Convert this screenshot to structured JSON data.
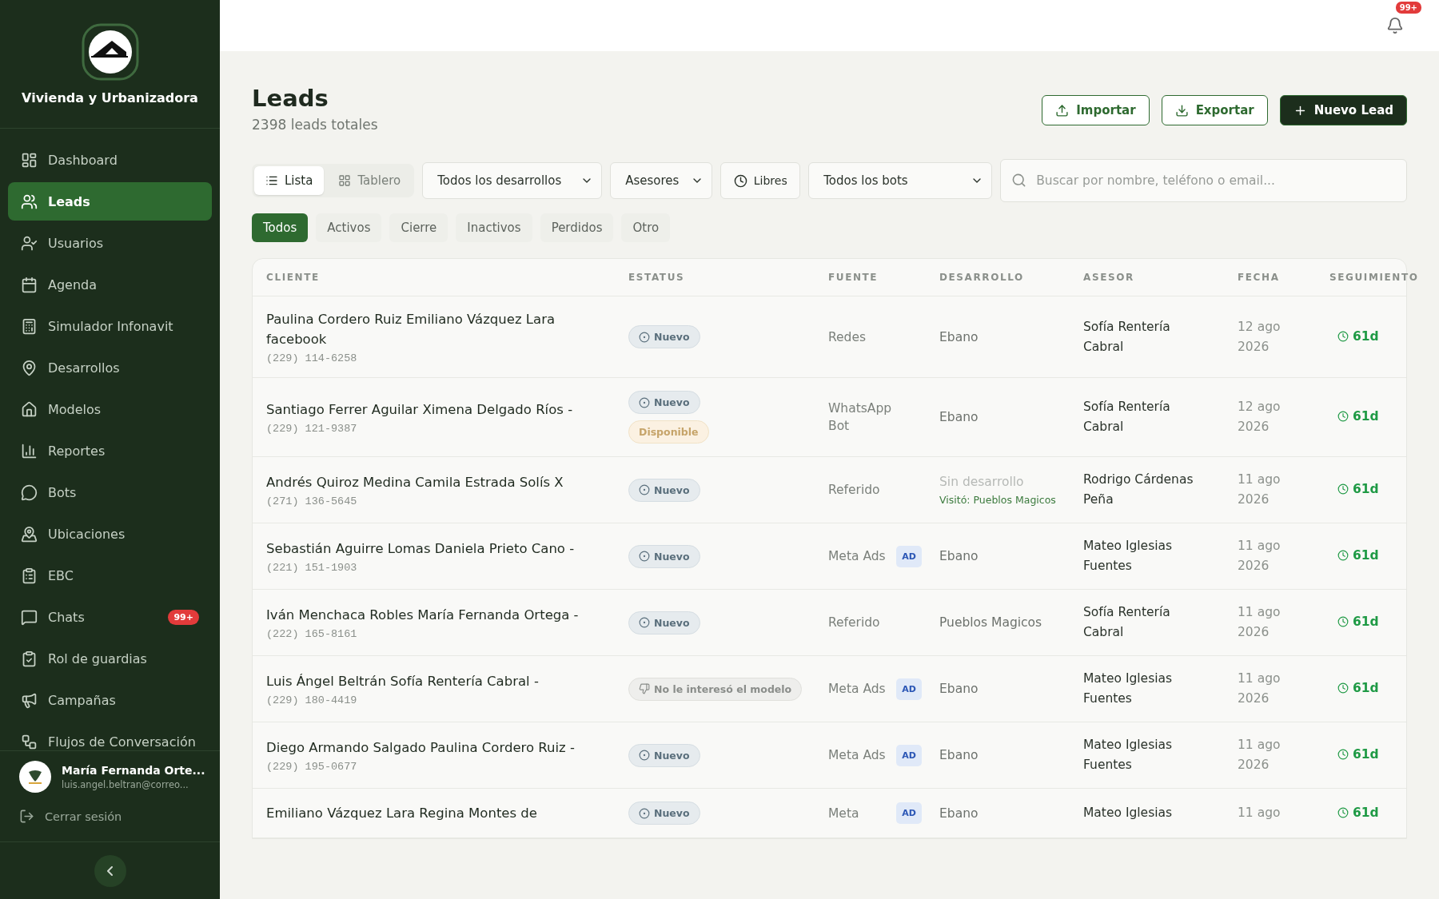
{
  "sidebar": {
    "brand": "Vivienda y Urbanizadora",
    "nav": [
      {
        "label": "Dashboard",
        "selected": false
      },
      {
        "label": "Leads",
        "selected": true
      },
      {
        "label": "Usuarios",
        "selected": false
      },
      {
        "label": "Agenda",
        "selected": false
      },
      {
        "label": "Simulador Infonavit",
        "selected": false
      },
      {
        "label": "Desarrollos",
        "selected": false
      },
      {
        "label": "Modelos",
        "selected": false
      },
      {
        "label": "Reportes",
        "selected": false
      },
      {
        "label": "Bots",
        "selected": false
      },
      {
        "label": "Ubicaciones",
        "selected": false
      },
      {
        "label": "EBC",
        "selected": false
      },
      {
        "label": "Chats",
        "selected": false,
        "badge": "99+"
      },
      {
        "label": "Rol de guardias",
        "selected": false
      },
      {
        "label": "Campañas",
        "selected": false
      },
      {
        "label": "Flujos de Conversación",
        "selected": false
      }
    ],
    "user": {
      "name": "María Fernanda Orte...",
      "email": "luis.angel.beltran@correo..."
    },
    "logout": "Cerrar sesión"
  },
  "topbar": {
    "notifications": "99+"
  },
  "header": {
    "title": "Leads",
    "subtitle": "2398 leads totales",
    "actions": [
      {
        "label": "Importar",
        "kind": "import"
      },
      {
        "label": "Exportar",
        "kind": "export"
      },
      {
        "label": "Nuevo Lead",
        "kind": "new"
      }
    ]
  },
  "views": [
    {
      "label": "Lista",
      "selected": true
    },
    {
      "label": "Tablero",
      "selected": false
    }
  ],
  "filters": [
    {
      "label": "Todos los desarrollos",
      "kind": "select"
    },
    {
      "label": "Asesores",
      "kind": "menu"
    },
    {
      "label": "Libres",
      "kind": "toggle"
    },
    {
      "label": "Todos los bots",
      "kind": "select"
    }
  ],
  "search": {
    "placeholder": "Buscar por nombre, teléfono o email..."
  },
  "tabs": [
    {
      "label": "Todos",
      "selected": true
    },
    {
      "label": "Activos",
      "selected": false
    },
    {
      "label": "Cierre",
      "selected": false
    },
    {
      "label": "Inactivos",
      "selected": false
    },
    {
      "label": "Perdidos",
      "selected": false
    },
    {
      "label": "Otro",
      "selected": false
    }
  ],
  "table": {
    "columns": [
      "CLIENTE",
      "ESTATUS",
      "FUENTE",
      "DESARROLLO",
      "ASESOR",
      "FECHA",
      "SEGUIMIENTO"
    ],
    "rows": [
      {
        "name": "Paulina Cordero Ruiz Emiliano Vázquez Lara facebook",
        "phone": "(229) 114-6258",
        "status": [
          {
            "label": "Nuevo",
            "kind": "new"
          }
        ],
        "source": "Redes",
        "development": {
          "name": "Ebano",
          "kind": "set"
        },
        "advisor": "Sofía Rentería Cabral",
        "date": "12 ago 2026",
        "followup": "61d"
      },
      {
        "name": "Santiago Ferrer Aguilar Ximena Delgado Ríos -",
        "phone": "(229) 121-9387",
        "status": [
          {
            "label": "Nuevo",
            "kind": "new"
          },
          {
            "label": "Disponible",
            "kind": "available"
          }
        ],
        "source": "WhatsApp Bot",
        "development": {
          "name": "Ebano",
          "kind": "set"
        },
        "advisor": "Sofía Rentería Cabral",
        "date": "12 ago 2026",
        "followup": "61d"
      },
      {
        "name": "Andrés Quiroz Medina Camila Estrada Solís X",
        "phone": "(271) 136-5645",
        "status": [
          {
            "label": "Nuevo",
            "kind": "new"
          }
        ],
        "source": "Referido",
        "development": {
          "name": "Sin desarrollo",
          "kind": "none",
          "note": "Visitó: Pueblos Magicos"
        },
        "advisor": "Rodrigo Cárdenas Peña",
        "date": "11 ago 2026",
        "followup": "61d"
      },
      {
        "name": "Sebastián Aguirre Lomas Daniela Prieto Cano -",
        "phone": "(221) 151-1903",
        "status": [
          {
            "label": "Nuevo",
            "kind": "new"
          }
        ],
        "source": "Meta Ads",
        "ad": "AD",
        "development": {
          "name": "Ebano",
          "kind": "set"
        },
        "advisor": "Mateo Iglesias Fuentes",
        "date": "11 ago 2026",
        "followup": "61d"
      },
      {
        "name": "Iván Menchaca Robles María Fernanda Ortega -",
        "phone": "(222) 165-8161",
        "status": [
          {
            "label": "Nuevo",
            "kind": "new"
          }
        ],
        "source": "Referido",
        "development": {
          "name": "Pueblos Magicos",
          "kind": "set"
        },
        "advisor": "Sofía Rentería Cabral",
        "date": "11 ago 2026",
        "followup": "61d"
      },
      {
        "name": "Luis Ángel Beltrán Sofía Rentería Cabral -",
        "phone": "(229) 180-4419",
        "status": [
          {
            "label": "No le interesó el modelo",
            "kind": "rejected"
          }
        ],
        "source": "Meta Ads",
        "ad": "AD",
        "development": {
          "name": "Ebano",
          "kind": "set"
        },
        "advisor": "Mateo Iglesias Fuentes",
        "date": "11 ago 2026",
        "followup": "61d"
      },
      {
        "name": "Diego Armando Salgado Paulina Cordero Ruiz -",
        "phone": "(229) 195-0677",
        "status": [
          {
            "label": "Nuevo",
            "kind": "new"
          }
        ],
        "source": "Meta Ads",
        "ad": "AD",
        "development": {
          "name": "Ebano",
          "kind": "set"
        },
        "advisor": "Mateo Iglesias Fuentes",
        "date": "11 ago 2026",
        "followup": "61d"
      },
      {
        "name": "Emiliano Vázquez Lara Regina Montes de",
        "status": [
          {
            "label": "Nuevo",
            "kind": "new"
          }
        ],
        "source": "Meta",
        "ad": "AD",
        "development": {
          "name": "Ebano",
          "kind": "set"
        },
        "advisor": "Mateo Iglesias",
        "date": "11 ago",
        "followup": "61d"
      }
    ]
  }
}
